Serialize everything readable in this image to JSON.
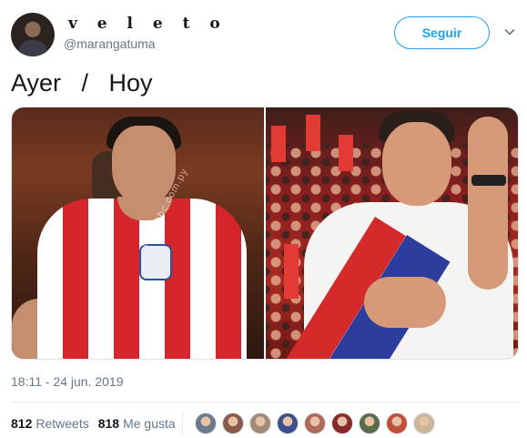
{
  "user": {
    "display_name": "v e l e t o",
    "handle": "@marangatuma",
    "follow_label": "Seguir",
    "avatar_icon": "profile-photo"
  },
  "tweet": {
    "text": "Ayer   /   Hoy",
    "timestamp": "18:11 - 24 jun. 2019",
    "media": [
      {
        "name": "left-photo",
        "watermark": "www.abc.com.py"
      },
      {
        "name": "right-photo"
      }
    ]
  },
  "stats": {
    "retweets_count": "812",
    "retweets_label": "Retweets",
    "likes_count": "818",
    "likes_label": "Me gusta"
  },
  "likers": [
    {
      "color": "#6b7b8c"
    },
    {
      "color": "#8c5a4a"
    },
    {
      "color": "#a08a7a"
    },
    {
      "color": "#3a4f8c"
    },
    {
      "color": "#b06a5a"
    },
    {
      "color": "#8a2a2a"
    },
    {
      "color": "#5a6a4a"
    },
    {
      "color": "#c0503a"
    },
    {
      "color": "#c9b59a"
    }
  ],
  "colors": {
    "accent": "#1da1f2",
    "secondary_text": "#657786"
  }
}
